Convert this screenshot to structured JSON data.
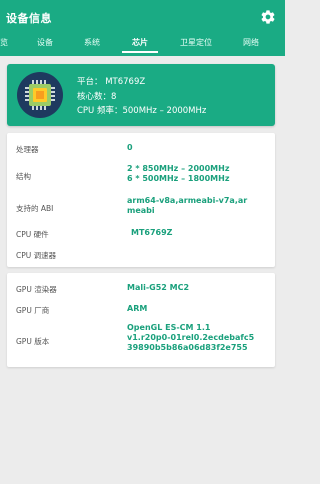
{
  "app": {
    "title": "设备信息",
    "accent": "#1aab84"
  },
  "tabs": [
    {
      "label": "览"
    },
    {
      "label": "设备"
    },
    {
      "label": "系统"
    },
    {
      "label": "芯片",
      "active": true
    },
    {
      "label": "卫星定位"
    },
    {
      "label": "网络"
    }
  ],
  "chip": {
    "platform": "平台： MT6769Z",
    "cores": "核心数：8",
    "freq": "CPU 频率：500MHz – 2000MHz"
  },
  "cpu_rows": [
    {
      "label": "处理器",
      "value": "0"
    },
    {
      "label": "结构",
      "value": "2 * 850MHz – 2000MHz\n6 * 500MHz – 1800MHz"
    },
    {
      "label": "支持的 ABI",
      "value": "arm64-v8a,armeabi-v7a,ar\nmeabi"
    },
    {
      "label": "CPU 硬件",
      "value": "MT6769Z"
    },
    {
      "label": "CPU 调速器",
      "value": ""
    }
  ],
  "gpu_rows": [
    {
      "label": "GPU 渲染器",
      "value": "Mali-G52 MC2"
    },
    {
      "label": "GPU 厂商",
      "value": "ARM"
    },
    {
      "label": "GPU 版本",
      "value": "OpenGL ES-CM 1.1\nv1.r20p0-01rel0.2ecdebafc5\n39890b5b86a06d83f2e755"
    }
  ],
  "icons": {
    "settings": "gear-icon",
    "chip": "cpu-chip-icon"
  }
}
